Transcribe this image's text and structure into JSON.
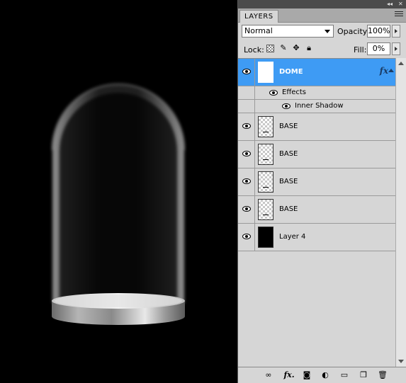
{
  "panel": {
    "tab_label": "LAYERS",
    "top_controls": "◂◂ ✕",
    "blend_mode": "Normal",
    "opacity_label": "Opacity:",
    "opacity_value": "100%",
    "lock_label": "Lock:",
    "fill_label": "Fill:",
    "fill_value": "0%"
  },
  "layers": [
    {
      "name": "DOME",
      "selected": true,
      "thumb": "white",
      "fx": "fx"
    },
    {
      "effects_label": "Effects",
      "effect": "Inner Shadow"
    },
    {
      "name": "BASE",
      "thumb": "transparent"
    },
    {
      "name": "BASE",
      "thumb": "transparent"
    },
    {
      "name": "BASE",
      "thumb": "transparent"
    },
    {
      "name": "BASE",
      "thumb": "transparent"
    },
    {
      "name": "Layer 4",
      "thumb": "black"
    }
  ],
  "bottom_icons": [
    "link-icon",
    "fx-icon",
    "mask-icon",
    "adjustment-icon",
    "folder-icon",
    "new-layer-icon",
    "trash-icon"
  ],
  "bottom_fx_label": "fx.",
  "colors": {
    "selected": "#3e9bf4",
    "panel_bg": "#d6d6d6",
    "canvas_bg": "#000000"
  }
}
